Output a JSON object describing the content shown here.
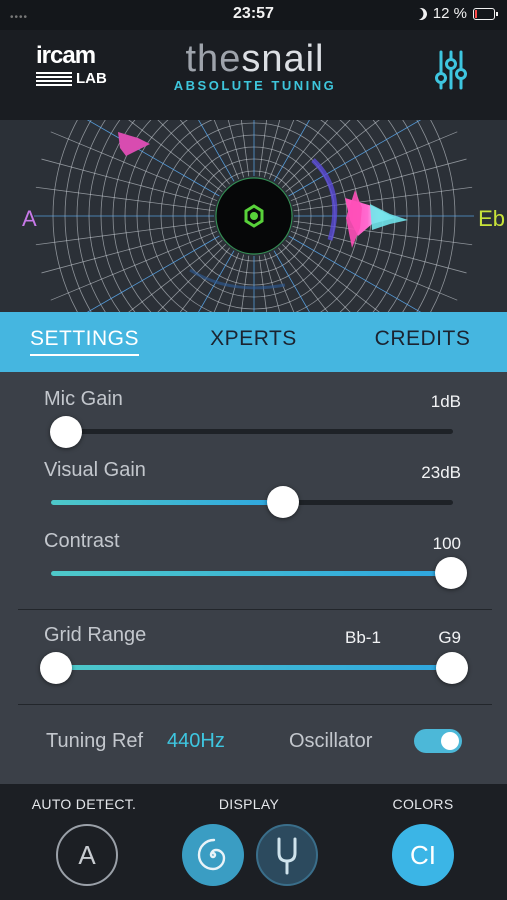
{
  "status_bar": {
    "signal": "••••",
    "time": "23:57",
    "battery_percent": "12 %",
    "battery_level": 0.12,
    "dnd_icon": "moon-icon"
  },
  "header": {
    "logo_top": "ircam",
    "logo_bottom": "LAB",
    "app_name_part1": "the",
    "app_name_part2": "snail",
    "tagline": "ABSOLUTE TUNING",
    "settings_icon": "sliders-icon"
  },
  "display": {
    "note_left": "A",
    "note_right": "Eb"
  },
  "tabs": [
    {
      "label": "SETTINGS",
      "active": true
    },
    {
      "label": "XPERTS",
      "active": false
    },
    {
      "label": "CREDITS",
      "active": false
    }
  ],
  "settings": {
    "mic_gain": {
      "label": "Mic Gain",
      "value": "1dB",
      "level": 0.0
    },
    "visual_gain": {
      "label": "Visual Gain",
      "value": "23dB",
      "level": 0.58
    },
    "contrast": {
      "label": "Contrast",
      "value": "100",
      "level": 1.0
    },
    "grid_range": {
      "label": "Grid Range",
      "min_value": "Bb-1",
      "max_value": "G9",
      "low": 0.0,
      "high": 1.0
    },
    "tuning_ref": {
      "label": "Tuning Ref",
      "value": "440Hz"
    },
    "oscillator": {
      "label": "Oscillator",
      "on": true
    }
  },
  "bottom_bar": {
    "auto_detect": {
      "label": "AUTO DETECT.",
      "button_text": "A"
    },
    "display": {
      "label": "DISPLAY",
      "spiral_icon": "spiral-icon",
      "fork_icon": "tuning-fork-icon"
    },
    "colors": {
      "label": "COLORS",
      "button_text": "CI"
    }
  },
  "colors": {
    "accent": "#45b6e0",
    "panel": "#3b4048",
    "header": "#1a1d22",
    "note_left": "#c779e8",
    "note_right": "#c8e23a"
  }
}
